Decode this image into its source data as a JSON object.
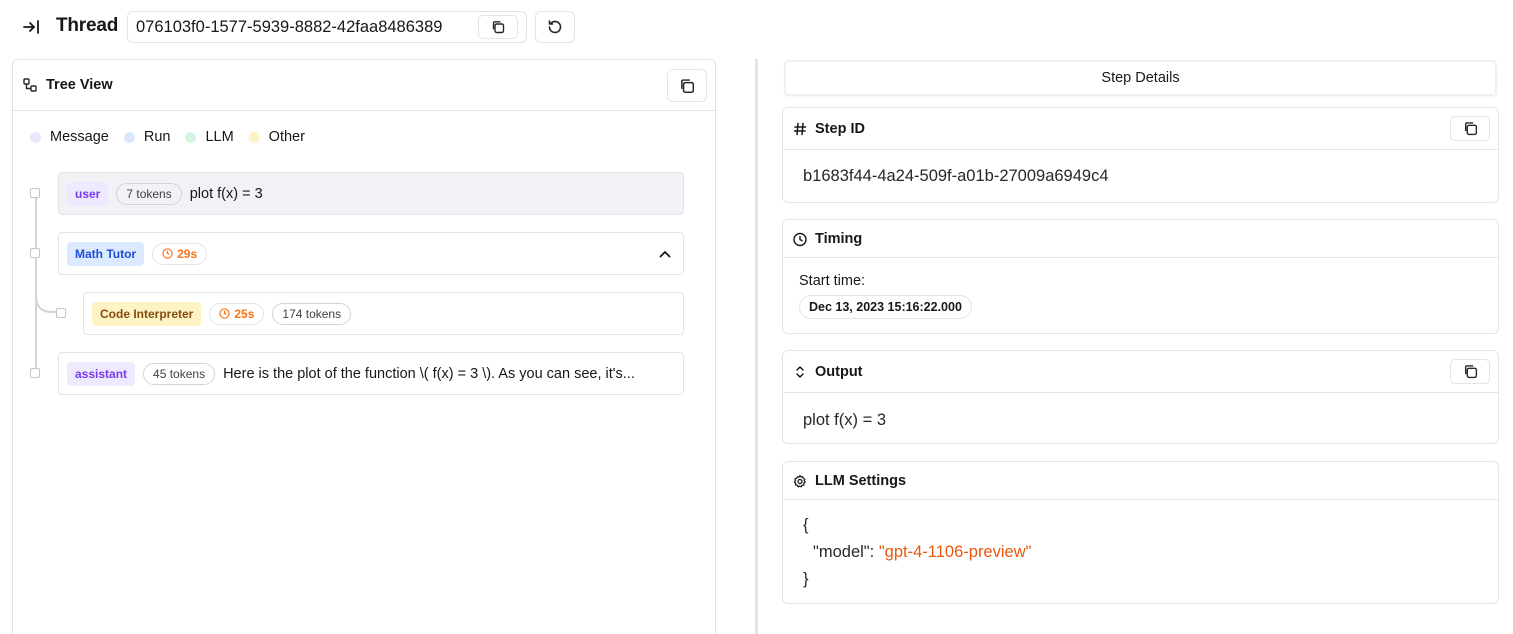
{
  "header": {
    "title": "Thread",
    "thread_id": "076103f0-1577-5939-8882-42faa8486389"
  },
  "tree": {
    "title": "Tree View",
    "legend": [
      {
        "label": "Message",
        "color": "#e9e7fb"
      },
      {
        "label": "Run",
        "color": "#dbe7fb"
      },
      {
        "label": "LLM",
        "color": "#d7f5e3"
      },
      {
        "label": "Other",
        "color": "#fdf3c4"
      }
    ],
    "rows": [
      {
        "badge": "user",
        "tokens": "7 tokens",
        "text": "plot f(x) = 3"
      },
      {
        "badge": "Math Tutor",
        "duration": "29s"
      },
      {
        "badge": "Code Interpreter",
        "duration": "25s",
        "tokens": "174 tokens"
      },
      {
        "badge": "assistant",
        "tokens": "45 tokens",
        "text": "Here is the plot of the function \\( f(x) = 3 \\). As you can see, it's..."
      }
    ]
  },
  "details": {
    "tab": "Step Details",
    "step_id": {
      "title": "Step ID",
      "value": "b1683f44-4a24-509f-a01b-27009a6949c4"
    },
    "timing": {
      "title": "Timing",
      "start_label": "Start time:",
      "start_value": "Dec 13, 2023 15:16:22.000"
    },
    "output": {
      "title": "Output",
      "value": "plot f(x) = 3"
    },
    "llm_settings": {
      "title": "LLM Settings",
      "open_brace": "{",
      "key": "\"model\"",
      "colon": ": ",
      "value": "\"gpt-4-1106-preview\"",
      "close_brace": "}"
    }
  }
}
